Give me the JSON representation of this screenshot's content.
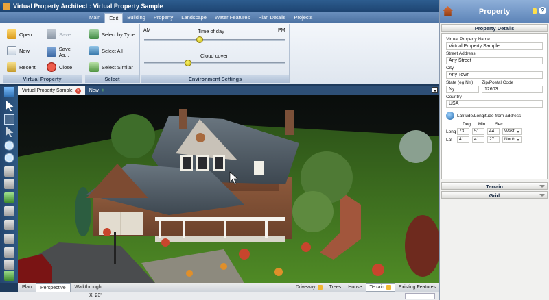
{
  "window": {
    "title": "Virtual Property Architect : Virtual Property Sample"
  },
  "menu": {
    "tabs": [
      "Main",
      "Edit",
      "Building",
      "Property",
      "Landscape",
      "Water Features",
      "Plan Details",
      "Projects"
    ],
    "active": "Edit"
  },
  "ribbon": {
    "virtual_property": {
      "caption": "Virtual Property",
      "open": "Open...",
      "save": "Save",
      "new": "New",
      "save_as": "Save As...",
      "recent": "Recent",
      "close": "Close"
    },
    "select": {
      "caption": "Select",
      "select_by_type": "Select by Type",
      "select_all": "Select All",
      "select_similar": "Select Similar"
    },
    "environment": {
      "caption": "Environment Settings",
      "time_of_day": "Time of day",
      "am": "AM",
      "pm": "PM",
      "cloud_cover": "Cloud cover",
      "time_level": 0.39,
      "cloud_level": 0.3
    }
  },
  "doc_tabs": {
    "active": "Virtual Property Sample",
    "new": "New"
  },
  "view_bar": {
    "tabs": [
      "Plan",
      "Perspective",
      "Walkthrough"
    ],
    "active_tab": "Perspective",
    "layers": [
      "Driveway",
      "Trees",
      "House",
      "Terrain",
      "Existing Features"
    ],
    "active_layer": "Terrain"
  },
  "status": {
    "x_label": "X: 23'"
  },
  "panel": {
    "title": "Property",
    "details_title": "Property Details",
    "name_label": "Virtual Property Name",
    "name_value": "Virtual Property Sample",
    "street_label": "Street Address",
    "street_value": "Any Street",
    "city_label": "City",
    "city_value": "Any Town",
    "state_label": "State (eg NY)",
    "state_value": "Ny",
    "zip_label": "Zip/Postal Code",
    "zip_value": "12603",
    "country_label": "Country",
    "country_value": "USA",
    "latlong_label": "Latitude/Longitude from address",
    "coord_heads": {
      "deg": "Deg.",
      "min": "Min.",
      "sec": "Sec."
    },
    "long": {
      "label": "Long",
      "deg": "73",
      "min": "51",
      "sec": "44",
      "dir": "West"
    },
    "lat": {
      "label": "Lat",
      "deg": "41",
      "min": "41",
      "sec": "27",
      "dir": "North"
    },
    "terrain_title": "Terrain",
    "grid_title": "Grid"
  }
}
